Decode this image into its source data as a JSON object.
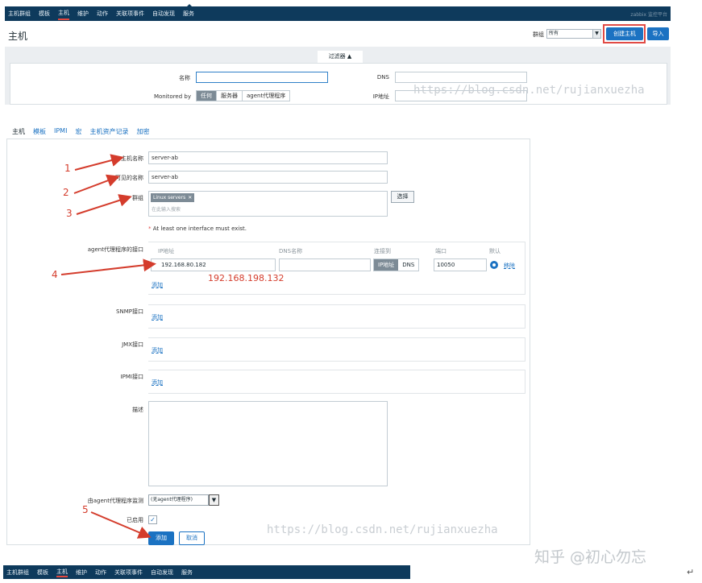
{
  "topnav": {
    "items": [
      "主机群组",
      "模板",
      "主机",
      "维护",
      "动作",
      "关联项事件",
      "自动发现",
      "服务"
    ],
    "active_index": 2,
    "brand": "zabbix 监控平台"
  },
  "header": {
    "title": "主机",
    "group_label": "群组",
    "group_value": "所有",
    "create_button": "创建主机",
    "import_button": "导入"
  },
  "filter": {
    "tab_label": "过滤器 ▲",
    "name_label": "名称",
    "name_value": "",
    "dns_label": "DNS",
    "ip_label": "IP地址",
    "monitored_by_label": "Monitored by",
    "monitored_by_options": [
      "任何",
      "服务器",
      "agent代理程序"
    ],
    "monitored_by_selected": 0
  },
  "watermark": {
    "text": "https://blog.csdn.net/rujianxuezha",
    "zhihu": "知乎 @初心勿忘"
  },
  "form": {
    "tabs": [
      "主机",
      "模板",
      "IPMI",
      "宏",
      "主机资产记录",
      "加密"
    ],
    "active_tab": 0,
    "host_name_label": "主机名称",
    "host_name_value": "server-ab",
    "visible_name_label": "可见的名称",
    "visible_name_value": "server-ab",
    "groups_label": "群组",
    "group_tag": "Linux servers",
    "group_tag_remove": "✕",
    "groups_search_placeholder": "在此输入搜索",
    "select_button": "选择",
    "interface_warning": "At least one interface must exist.",
    "agent_interfaces": {
      "label": "agent代理程序的接口",
      "headers": [
        "IP地址",
        "DNS名称",
        "连接到",
        "端口",
        "默认"
      ],
      "ip_value": "192.168.80.182",
      "dns_value": "",
      "connect_options": [
        "IP地址",
        "DNS"
      ],
      "connect_selected": 0,
      "port_value": "10050",
      "remove_link": "移除",
      "add_link": "添加"
    },
    "snmp": {
      "label": "SNMP接口",
      "add_link": "添加"
    },
    "jmx": {
      "label": "JMX接口",
      "add_link": "添加"
    },
    "ipmi": {
      "label": "IPMI接口",
      "add_link": "添加"
    },
    "description_label": "描述",
    "description_value": "",
    "proxy_label": "由agent代理程序监测",
    "proxy_value": "(无agent代理程序)",
    "enabled_label": "已启用",
    "enabled_checked": true,
    "add_button": "添加",
    "cancel_button": "取消"
  },
  "annotations": {
    "numbers": [
      "1",
      "2",
      "3",
      "4",
      "5"
    ],
    "ip_note": "192.168.198.132",
    "color": "#d43c2c"
  },
  "bottom_nav": {
    "items": [
      "主机群组",
      "模板",
      "主机",
      "维护",
      "动作",
      "关联项事件",
      "自动发现",
      "服务"
    ],
    "active_index": 2
  },
  "enter_mark": "↵",
  "colors": {
    "nav_bg": "#0e3a5c",
    "primary": "#1b72c2",
    "annotation_red": "#d43c2c"
  }
}
